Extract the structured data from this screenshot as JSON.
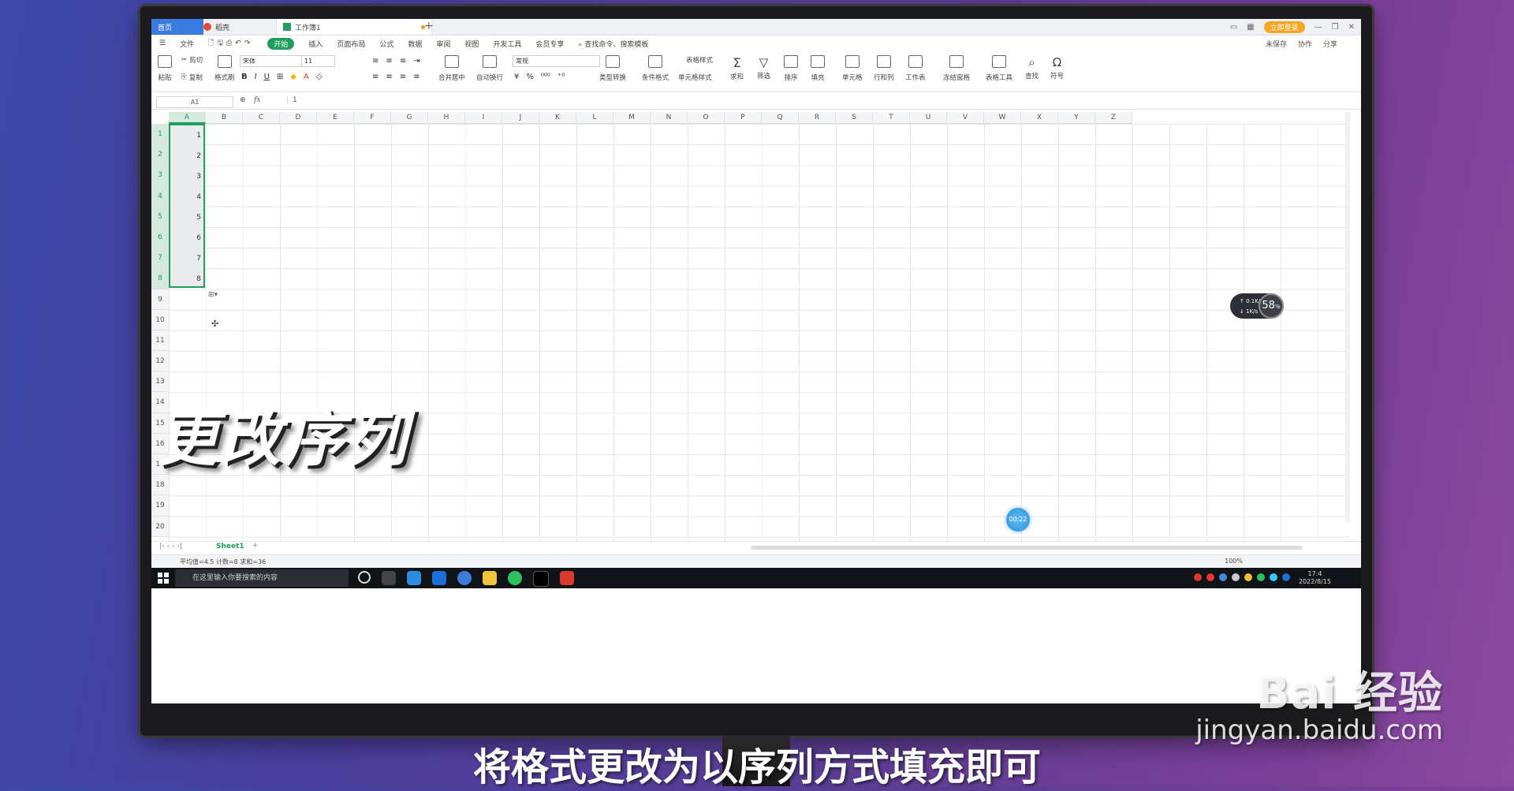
{
  "window": {
    "tabs": [
      {
        "label": "首页"
      },
      {
        "label": "稻壳"
      },
      {
        "label": "工作簿1"
      }
    ],
    "login_label": "立即登录"
  },
  "menu": {
    "items": [
      "文件",
      "开始",
      "插入",
      "页面布局",
      "公式",
      "数据",
      "审阅",
      "视图",
      "开发工具",
      "会员专享"
    ],
    "search_placeholder": "查找命令、搜索模板",
    "right": [
      "未保存",
      "协作",
      "分享"
    ]
  },
  "ribbon": {
    "groups": [
      "粘贴",
      "剪切",
      "复制",
      "格式刷",
      "合并居中",
      "自动换行",
      "类型转换",
      "条件格式",
      "表格样式",
      "单元格样式",
      "求和",
      "筛选",
      "排序",
      "填充",
      "单元格",
      "行和列",
      "工作表",
      "冻结窗格",
      "表格工具",
      "查找",
      "符号"
    ],
    "font_name": "宋体",
    "font_size": "11",
    "number_format": "常规"
  },
  "formula_bar": {
    "cell_ref": "A1",
    "fx": "fx",
    "value": "1"
  },
  "grid": {
    "columns": [
      "A",
      "B",
      "C",
      "D",
      "E",
      "F",
      "G",
      "H",
      "I",
      "J",
      "K",
      "L",
      "M",
      "N",
      "O",
      "P",
      "Q",
      "R",
      "S",
      "T",
      "U",
      "V",
      "W",
      "X",
      "Y",
      "Z"
    ],
    "rows": [
      "1",
      "2",
      "3",
      "4",
      "5",
      "6",
      "7",
      "8",
      "9",
      "10",
      "11",
      "12",
      "13",
      "14",
      "15",
      "16",
      "17",
      "18",
      "19",
      "20"
    ],
    "column_a_values": [
      "1",
      "2",
      "3",
      "4",
      "5",
      "6",
      "7",
      "8"
    ]
  },
  "sheet_bar": {
    "sheet_name": "Sheet1"
  },
  "status_bar": {
    "stats": "平均值=4.5  计数=8  求和=36",
    "zoom": "100%"
  },
  "taskbar": {
    "search_placeholder": "在这里输入你要搜索的内容",
    "time": "17:4",
    "date": "2022/8/15"
  },
  "widgets": {
    "upload": "0.1",
    "download": "1",
    "rate_unit": "K/s",
    "cpu_percent": "58",
    "percent_sign": "%",
    "timer": "00:22"
  },
  "overlay": {
    "title": "更改序列",
    "subtitle": "将格式更改为以序列方式填充即可"
  },
  "watermark": {
    "logo": "Bai 经验",
    "url": "jingyan.baidu.com"
  }
}
